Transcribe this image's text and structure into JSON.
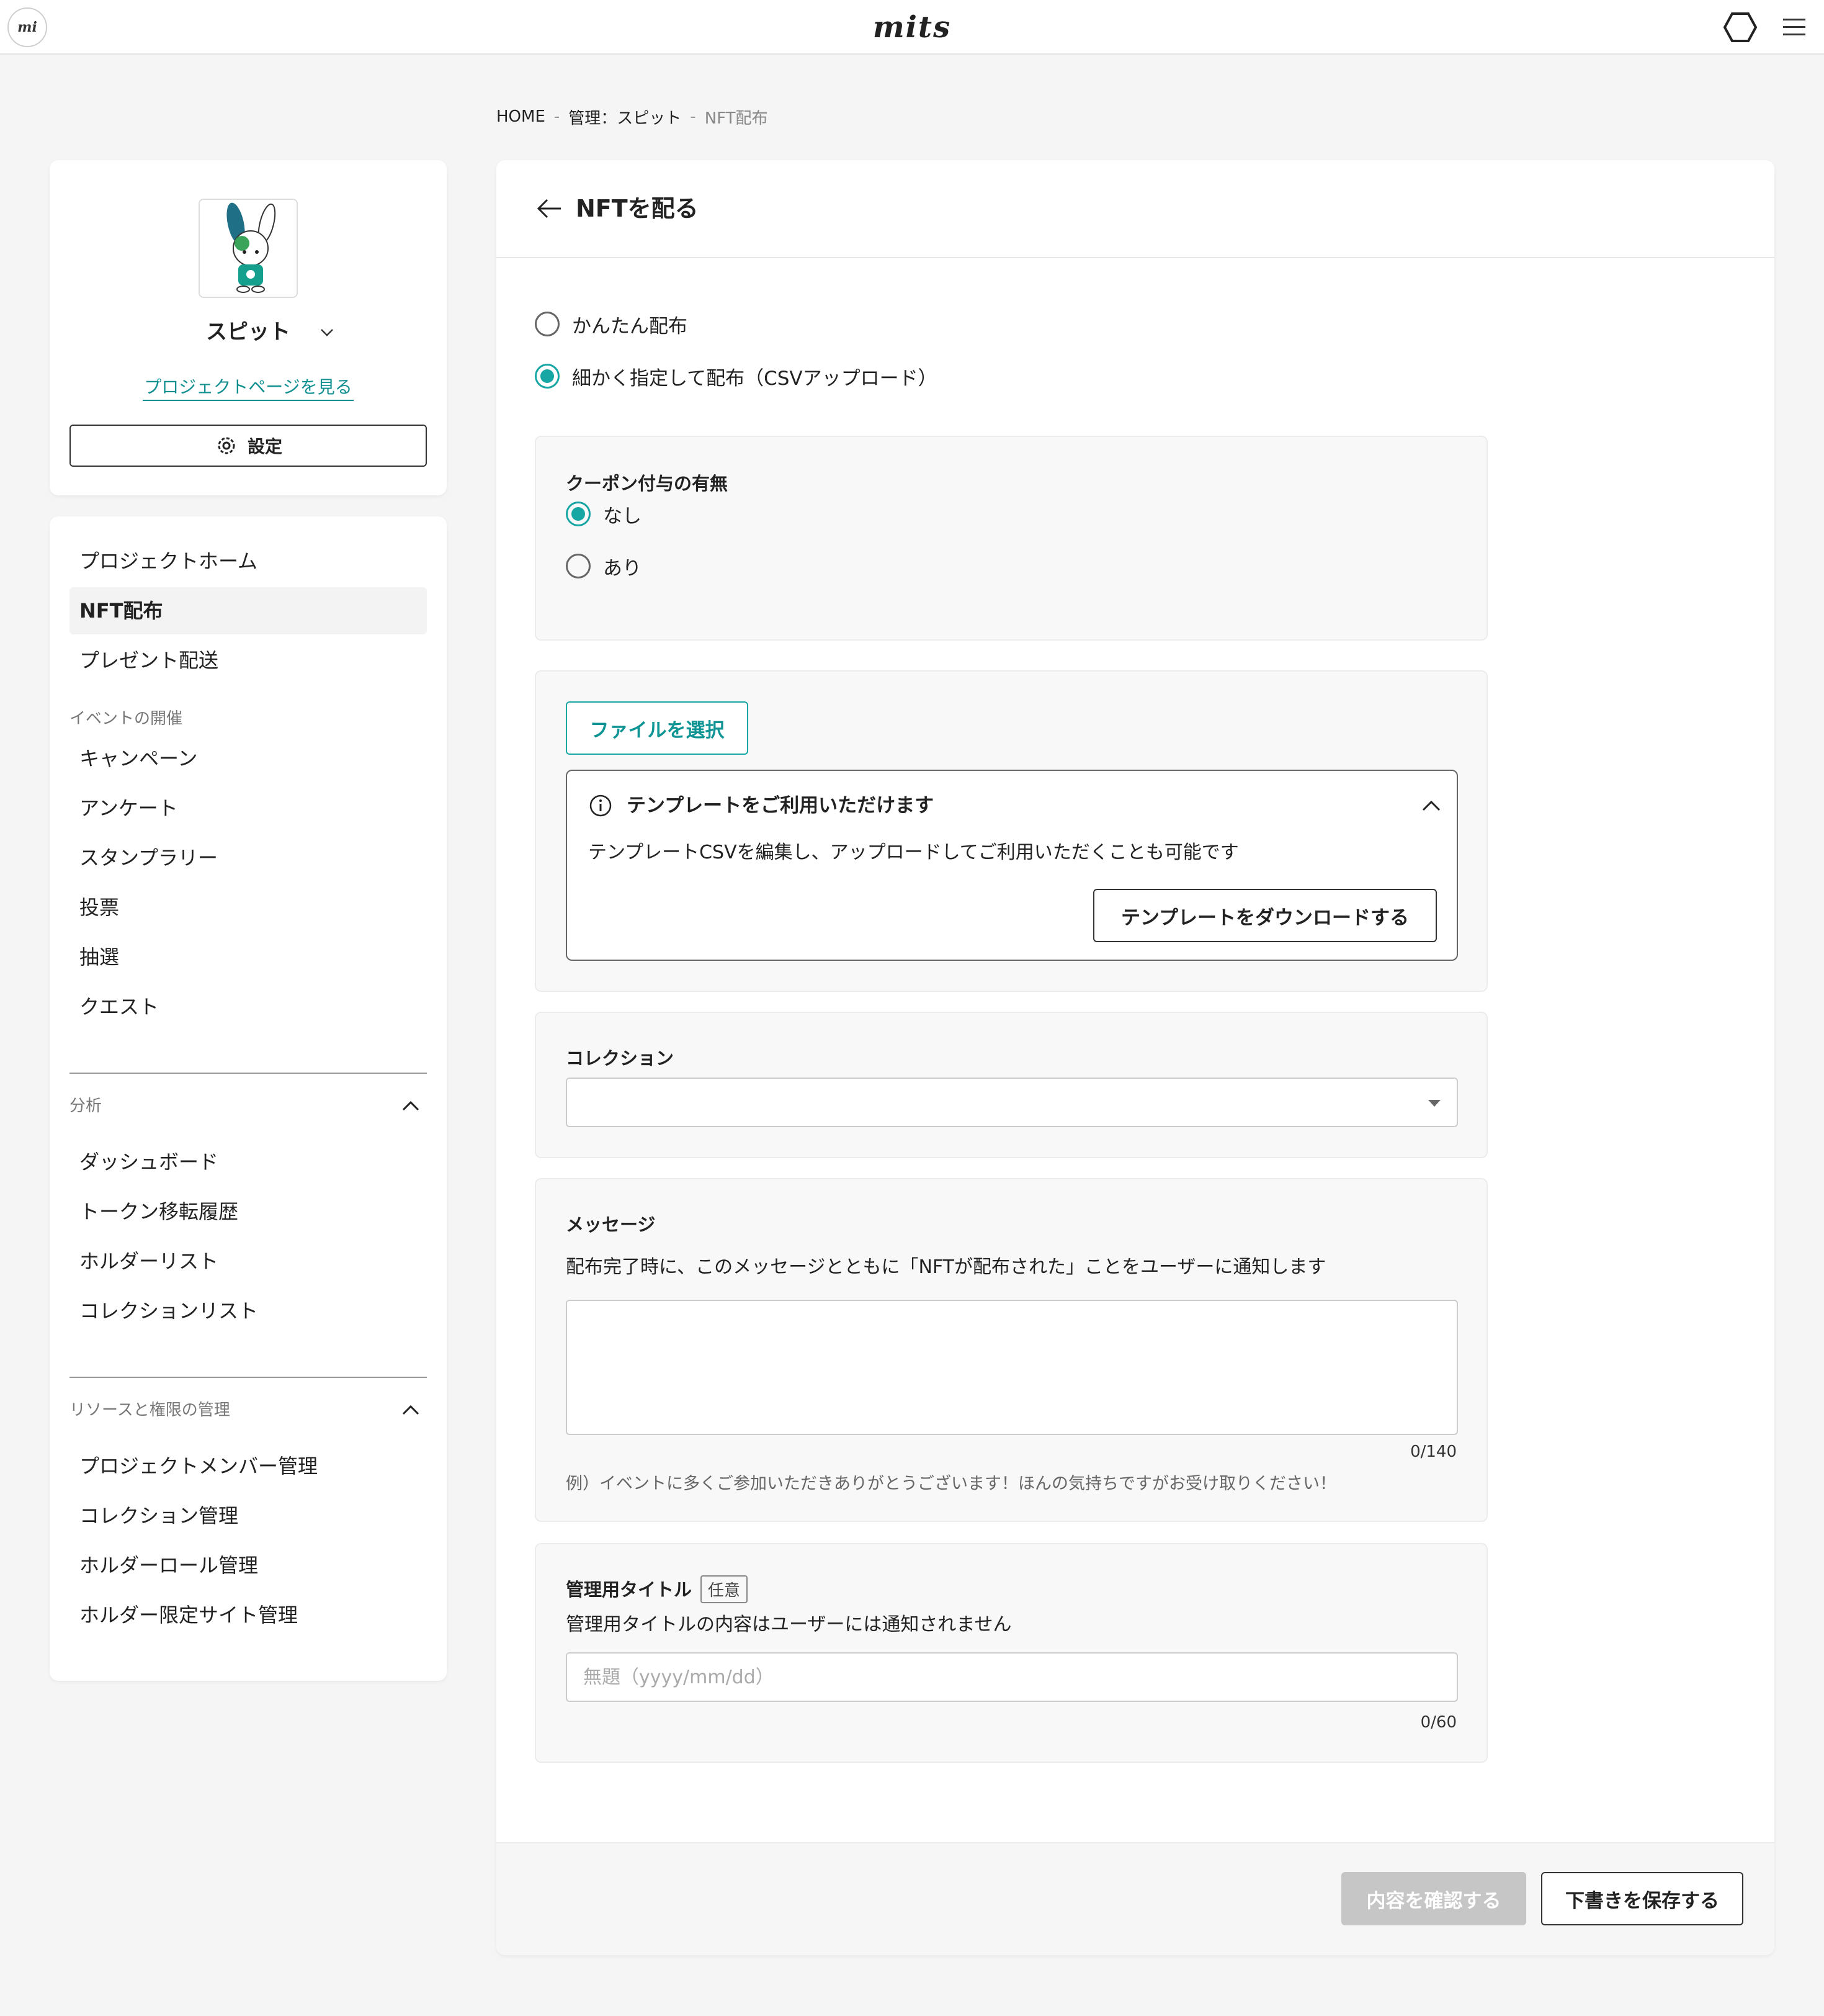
{
  "app": {
    "logo_mark": "mi",
    "brand": "mits",
    "accent_color": "#16a6a4",
    "icons": {
      "header_right": [
        "hexagon-icon",
        "hamburger-menu-icon"
      ]
    }
  },
  "breadcrumb": {
    "home": "HOME",
    "sep": "-",
    "project": "管理：スピット",
    "current": "NFT配布"
  },
  "profile": {
    "name": "スピット",
    "project_link": "プロジェクトページを見る",
    "settings_label": "設定"
  },
  "nav": {
    "top_items": [
      "プロジェクトホーム",
      "NFT配布",
      "プレゼント配送"
    ],
    "active": "NFT配布",
    "events_label": "イベントの開催",
    "event_items": [
      "キャンペーン",
      "アンケート",
      "スタンプラリー",
      "投票",
      "抽選",
      "クエスト"
    ],
    "analysis_label": "分析",
    "analysis_items": [
      "ダッシュボード",
      "トークン移転履歴",
      "ホルダーリスト",
      "コレクションリスト"
    ],
    "resources_label": "リソースと権限の管理",
    "resources_items": [
      "プロジェクトメンバー管理",
      "コレクション管理",
      "ホルダーロール管理",
      "ホルダー限定サイト管理"
    ]
  },
  "main": {
    "title": "NFTを配る",
    "distribution_options": [
      {
        "label": "かんたん配布",
        "checked": false
      },
      {
        "label": "細かく指定して配布（CSVアップロード）",
        "checked": true
      }
    ],
    "coupon": {
      "title": "クーポン付与の有無",
      "options": [
        {
          "label": "なし",
          "checked": true
        },
        {
          "label": "あり",
          "checked": false
        }
      ]
    },
    "file": {
      "select_label": "ファイルを選択",
      "template_title": "テンプレートをご利用いただけます",
      "template_desc": "テンプレートCSVを編集し、アップロードしてご利用いただくことも可能です",
      "download_label": "テンプレートをダウンロードする"
    },
    "collection": {
      "title": "コレクション",
      "value": ""
    },
    "message": {
      "title": "メッセージ",
      "desc": "配布完了時に、このメッセージとともに「NFTが配布された」ことをユーザーに通知します",
      "value": "",
      "counter": "0/140",
      "example": "例）イベントに多くご参加いただきありがとうございます！ほんの気持ちですがお受け取りください！"
    },
    "admin_title": {
      "title": "管理用タイトル",
      "badge": "任意",
      "desc": "管理用タイトルの内容はユーザーには通知されません",
      "placeholder": "無題（yyyy/mm/dd）",
      "counter": "0/60"
    },
    "footer": {
      "confirm_label": "内容を確認する",
      "draft_label": "下書きを保存する"
    }
  }
}
